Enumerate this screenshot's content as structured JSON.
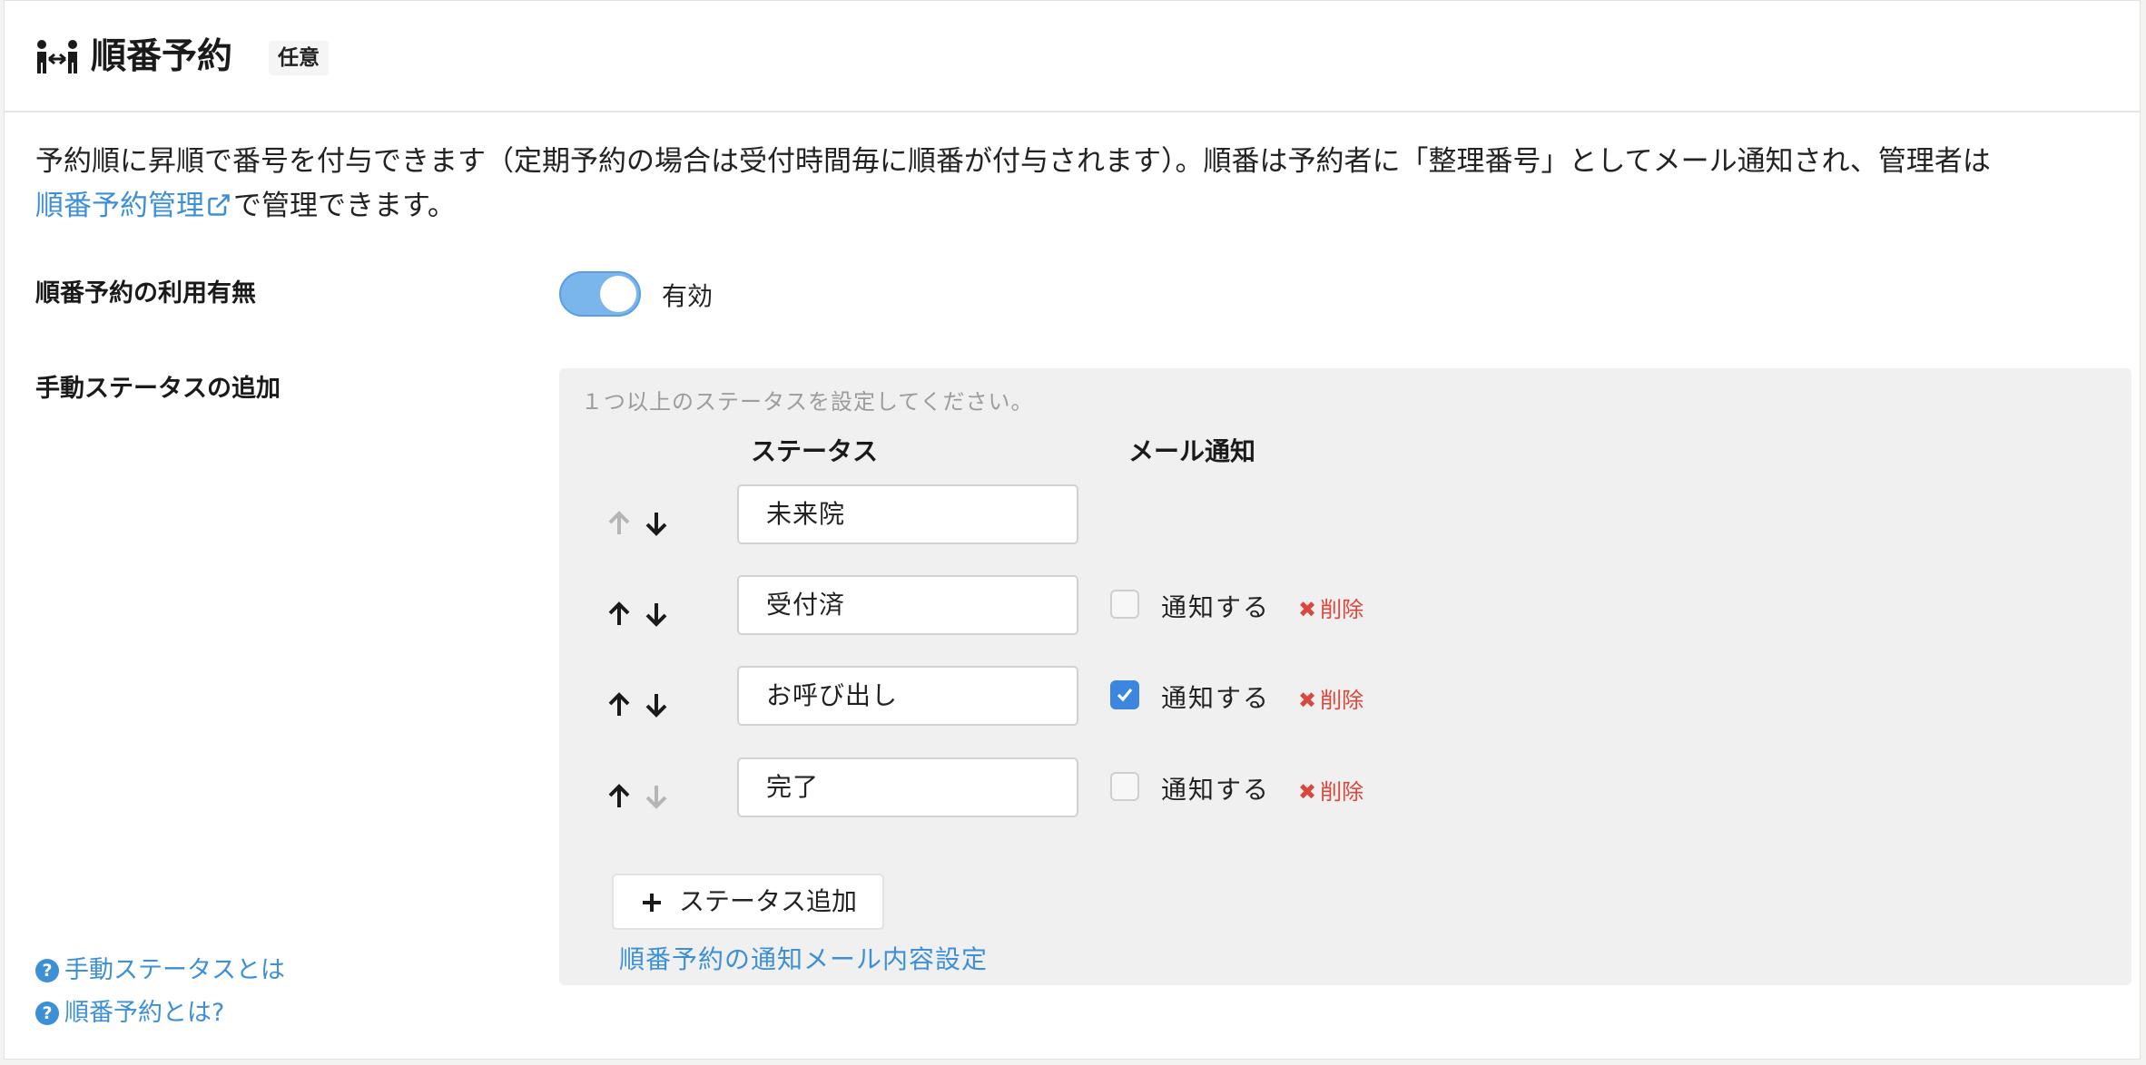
{
  "header": {
    "icon": "queue-people-icon",
    "title": "順番予約",
    "badge": "任意"
  },
  "description": {
    "text": "予約順に昇順で番号を付与できます（定期予約の場合は受付時間毎に順番が付与されます）。順番は予約者に「整理番号」としてメール通知され、管理者は",
    "link_label": "順番予約管理",
    "link_suffix": "で管理できます。"
  },
  "usage": {
    "label": "順番予約の利用有無",
    "toggle_state": "on",
    "toggle_label": "有効"
  },
  "manual_status": {
    "label": "手動ステータスの追加",
    "hint": "１つ以上のステータスを設定してください。",
    "column_status": "ステータス",
    "column_mail": "メール通知",
    "notify_label": "通知する",
    "delete_label": "削除",
    "rows": [
      {
        "value": "未来院",
        "up_enabled": false,
        "down_enabled": true,
        "has_notify": false,
        "notify_checked": false
      },
      {
        "value": "受付済",
        "up_enabled": true,
        "down_enabled": true,
        "has_notify": true,
        "notify_checked": false
      },
      {
        "value": "お呼び出し",
        "up_enabled": true,
        "down_enabled": true,
        "has_notify": true,
        "notify_checked": true
      },
      {
        "value": "完了",
        "up_enabled": true,
        "down_enabled": false,
        "has_notify": true,
        "notify_checked": false
      }
    ],
    "add_button": "ステータス追加",
    "mail_settings_link": "順番予約の通知メール内容設定"
  },
  "help": {
    "manual_status_link": "手動ステータスとは",
    "queue_link": "順番予約とは?"
  },
  "colors": {
    "accent": "#3d8fd6",
    "toggle_on": "#7ab5ec",
    "checkbox_checked": "#3d86e0",
    "delete": "#d9473d",
    "arrow_disabled": "#b5b5b5"
  }
}
